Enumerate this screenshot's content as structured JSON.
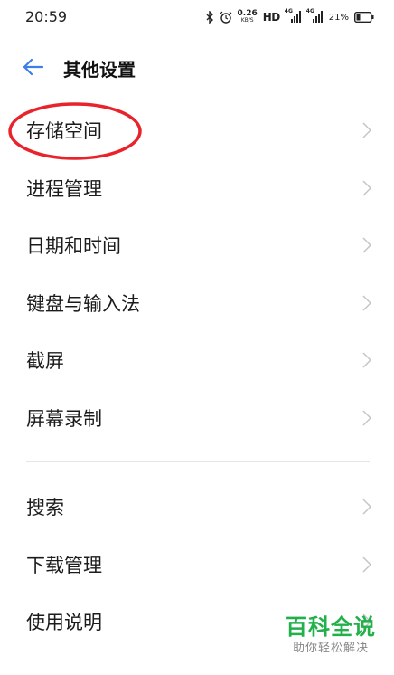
{
  "status_bar": {
    "time": "20:59",
    "speed_value": "0.26",
    "speed_unit": "KB/S",
    "hd_label": "HD",
    "signal1_tag": "4G",
    "signal2_tag": "4G",
    "battery_percent": "21%",
    "icons": [
      "bluetooth-icon",
      "alarm-icon",
      "signal-icon",
      "signal-icon",
      "battery-icon"
    ]
  },
  "header": {
    "title": "其他设置",
    "back_icon": "back-arrow-icon",
    "accent_color": "#3d7ee8"
  },
  "group1": [
    {
      "label": "存储空间"
    },
    {
      "label": "进程管理"
    },
    {
      "label": "日期和时间"
    },
    {
      "label": "键盘与输入法"
    },
    {
      "label": "截屏"
    },
    {
      "label": "屏幕录制"
    }
  ],
  "group2": [
    {
      "label": "搜索"
    },
    {
      "label": "下载管理"
    },
    {
      "label": "使用说明"
    }
  ],
  "annotation": {
    "color": "#e8232c"
  },
  "watermark": {
    "main": "百科全说",
    "sub": "助你轻松解决",
    "color": "#22b04b"
  }
}
